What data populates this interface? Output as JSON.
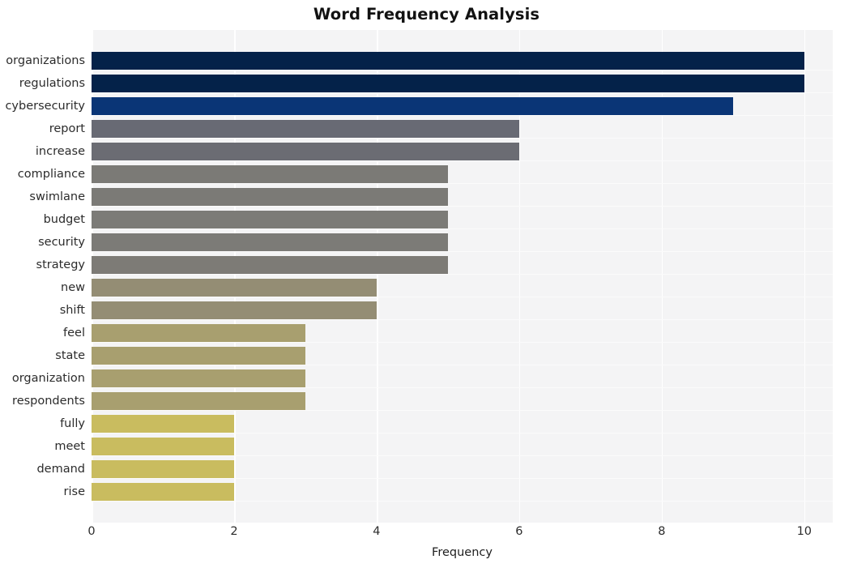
{
  "chart_data": {
    "type": "bar",
    "orientation": "horizontal",
    "title": "Word Frequency Analysis",
    "xlabel": "Frequency",
    "ylabel": "",
    "xlim": [
      0,
      10.4
    ],
    "xticks": [
      "0",
      "2",
      "4",
      "6",
      "8",
      "10"
    ],
    "xtick_values": [
      0,
      2,
      4,
      6,
      8,
      10
    ],
    "grid": true,
    "legend": null,
    "categories": [
      "organizations",
      "regulations",
      "cybersecurity",
      "report",
      "increase",
      "compliance",
      "swimlane",
      "budget",
      "security",
      "strategy",
      "new",
      "shift",
      "feel",
      "state",
      "organization",
      "respondents",
      "fully",
      "meet",
      "demand",
      "rise"
    ],
    "values": [
      10,
      10,
      9,
      6,
      6,
      5,
      5,
      5,
      5,
      5,
      4,
      4,
      3,
      3,
      3,
      3,
      2,
      2,
      2,
      2
    ],
    "colors": [
      "#042249",
      "#042249",
      "#0a3576",
      "#686a74",
      "#6b6c73",
      "#7b7a76",
      "#7b7a76",
      "#7c7b77",
      "#7c7b77",
      "#7d7b76",
      "#948d74",
      "#948d74",
      "#a89f6f",
      "#a89f6f",
      "#a89f6f",
      "#a89f6f",
      "#c9bc5f",
      "#c9bc5f",
      "#c9bc5f",
      "#c9bc5f"
    ],
    "plot_background": "#f4f4f5",
    "gridline_color": "#ffffff"
  }
}
